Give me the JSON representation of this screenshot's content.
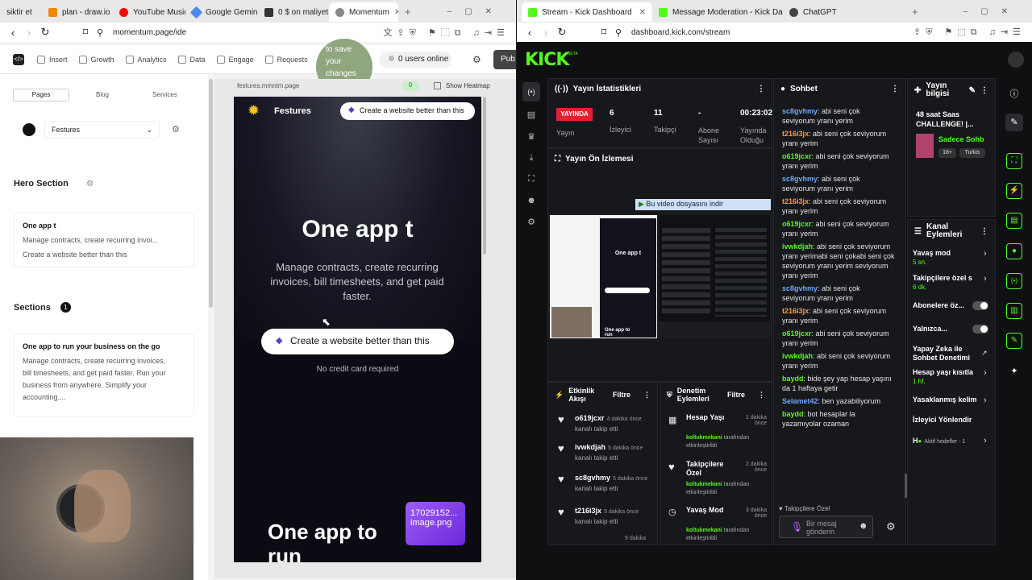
{
  "left_browser": {
    "tabs": [
      {
        "label": "siktir et",
        "color": "#999"
      },
      {
        "label": "plan - draw.io",
        "color": "#f08705"
      },
      {
        "label": "YouTube Music",
        "color": "#ff0000"
      },
      {
        "label": "Google Gemini",
        "color": "#4a8af4"
      },
      {
        "label": "0 $ on maliyet",
        "color": "#333"
      },
      {
        "label": "Momentum",
        "color": "#666"
      }
    ],
    "url": "momentum.page/ide",
    "toolbar": {
      "items": [
        "Insert",
        "Growth",
        "Analytics",
        "Data",
        "Engage",
        "Requests"
      ],
      "save_hint": "to save your changes →",
      "users_online": "0 users online",
      "publish": "Pub"
    },
    "left_tabs": [
      "Pages",
      "Blog",
      "Services"
    ],
    "page_select": "Festures",
    "hero_section": "Hero Section",
    "hero_card": {
      "title": "One app t",
      "desc": "Manage contracts, create recurring invoi...",
      "cta": "Create a website better than this"
    },
    "sections_label": "Sections",
    "sections_count": "1",
    "section_card": {
      "title": "One app to run your business on the go",
      "desc": "Manage contracts, create recurring invoices, bill timesheets, and get paid faster. Run your business from anywhere. Simplify your accounting...."
    },
    "preview_url": "festures.mmntm.page",
    "heatmap": "Show Heatmap",
    "heatmap_count": "0",
    "preview": {
      "brand": "Festures",
      "nav_cta": "Create a website better than this",
      "headline": "One app t",
      "sub": "Manage contracts, create recurring invoices, bill timesheets, and get paid faster.",
      "cta": "Create a website better than this",
      "note": "No credit card required",
      "bottom_headline": "One app to run",
      "img_label": "17029152... image.png"
    }
  },
  "right_browser": {
    "tabs": [
      {
        "label": "Stream - Kick Dashboard",
        "color": "#53fc18"
      },
      {
        "label": "Message Moderation - Kick Dashbo",
        "color": "#53fc18"
      },
      {
        "label": "ChatGPT",
        "color": "#444"
      }
    ],
    "url": "dashboard.kick.com/stream",
    "logo": "KICK",
    "beta": "BETA",
    "stats": {
      "title": "Yayın İstatistikleri",
      "live": "YAYINDA",
      "live_label": "Yayın",
      "viewers": "6",
      "viewers_label": "İzleyici",
      "followers": "11",
      "followers_label": "Takipçi",
      "subs": "-",
      "subs_label": "Abone Sayısı",
      "uptime": "00:23:02",
      "uptime_label": "Yayında Olduğu"
    },
    "preview_title": "Yayın Ön İzlemesi",
    "download_bar": "Bu video dosyasını indir",
    "stream_thumb": {
      "headline": "One app t",
      "bottom": "One app to run"
    },
    "chat": {
      "title": "Sohbet",
      "lines": [
        {
          "user": "sc8gvhmy",
          "color": "#6ea8ff",
          "msg": "abi seni çok seviyorum yranı yerim"
        },
        {
          "user": "t216i3jx",
          "color": "#ff9a3c",
          "msg": "abi seni çok seviyorum yranı yerim"
        },
        {
          "user": "o619jcxr",
          "color": "#53fc18",
          "msg": "abi seni çok seviyorum yranı yerim"
        },
        {
          "user": "sc8gvhmy",
          "color": "#6ea8ff",
          "msg": "abi seni çok seviyorum yranı yerim"
        },
        {
          "user": "t216i3jx",
          "color": "#ff9a3c",
          "msg": "abi seni çok seviyorum yranı yerim"
        },
        {
          "user": "o619jcxr",
          "color": "#53fc18",
          "msg": "abi seni çok seviyorum yranı yerim"
        },
        {
          "user": "ivwkdjah",
          "color": "#53fc18",
          "msg": "abi seni çok seviyorum yranı yerimabi seni çokabi seni çok seviyorum yranı yerim seviyorum yranı yerim"
        },
        {
          "user": "sc8gvhmy",
          "color": "#6ea8ff",
          "msg": "abi seni çok seviyorum yranı yerim"
        },
        {
          "user": "t216i3jx",
          "color": "#ff9a3c",
          "msg": "abi seni çok seviyorum yranı yerim"
        },
        {
          "user": "o619jcxr",
          "color": "#53fc18",
          "msg": "abi seni çok seviyorum yranı yerim"
        },
        {
          "user": "ivwkdjah",
          "color": "#53fc18",
          "msg": "abi seni çok seviyorum yranı yerim"
        },
        {
          "user": "baydd",
          "color": "#53fc18",
          "msg": "bide şey yap hesap yaşını da 1 haftaya getir"
        },
        {
          "user": "Selamet42",
          "color": "#6ea8ff",
          "msg": "ben yazabiliyorum"
        },
        {
          "user": "baydd",
          "color": "#53fc18",
          "msg": "bot hesaplar la yazamıyolar ozaman"
        }
      ],
      "footer_note": "Takipçilere Özel",
      "input_placeholder": "Bir mesaj gönderin"
    },
    "info": {
      "title": "Yayın bilgisi",
      "stream_title": "48 saat Saas CHALLENGE! |...",
      "category": "Sadece Sohb",
      "age": "18+",
      "lang": "Turkis"
    },
    "channel": {
      "title": "Kanal Eylemleri",
      "items": [
        {
          "label": "Yavaş mod",
          "sub": "5 sn."
        },
        {
          "label": "Takipçilere özel s",
          "sub": "6 dk."
        },
        {
          "label": "Abonelere öz...",
          "sub": ""
        },
        {
          "label": "Yalnızca...",
          "sub": ""
        },
        {
          "label": "Yapay Zeka ile Sohbet Denetimi",
          "sub": ""
        },
        {
          "label": "Hesap yaşı kısıtla",
          "sub": "1 hf."
        },
        {
          "label": "Yasaklanmış kelim",
          "sub": ""
        },
        {
          "label": "İzleyici Yönlendir",
          "sub": ""
        },
        {
          "label": "Aktif hedefler - 1",
          "sub": ""
        }
      ]
    },
    "activity": {
      "title": "Etkinlik Akışı",
      "filter": "Filtre",
      "items": [
        {
          "user": "o619jcxr",
          "time": "4 dakika önce",
          "text": "kanalı takip etti"
        },
        {
          "user": "ivwkdjah",
          "time": "5 dakika önce",
          "text": "kanalı takip etti"
        },
        {
          "user": "sc8gvhmy",
          "time": "5 dakika önce",
          "text": "kanalı takip etti"
        },
        {
          "user": "t216i3jx",
          "time": "5 dakika önce",
          "text": "kanalı takip etti"
        },
        {
          "user": "",
          "time": "9 dakika",
          "text": ""
        }
      ]
    },
    "moderation": {
      "title": "Denetim Eylemleri",
      "filter": "Filtre",
      "items": [
        {
          "title": "Hesap Yaşı",
          "time": "1 dakika önce",
          "by": "koltukmekani",
          "by_suffix": "tarafından etkinleştirildi"
        },
        {
          "title": "Takipçilere Özel",
          "time": "2 dakika önce",
          "by": "koltukmekani",
          "by_suffix": "tarafından etkinleştirildi"
        },
        {
          "title": "Yavaş Mod",
          "time": "3 dakika önce",
          "by": "koltukmekani",
          "by_suffix": "tarafından etkinleştirildi"
        }
      ]
    }
  },
  "colors": {
    "kick_green": "#53fc18",
    "momentum_green": "#8fa67e"
  }
}
